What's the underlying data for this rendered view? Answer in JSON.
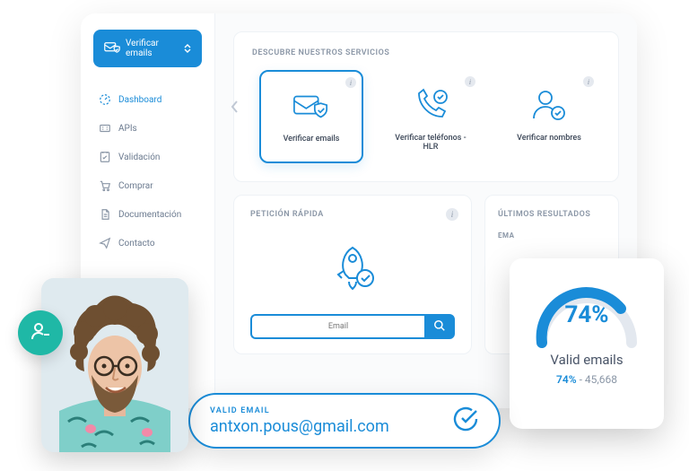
{
  "colors": {
    "primary": "#1a8cd8",
    "teal": "#1fb8a6",
    "muted": "#8a96a6"
  },
  "dropdown": {
    "label": "Verificar emails"
  },
  "nav": {
    "items": [
      {
        "label": "Dashboard",
        "icon": "dashboard-icon"
      },
      {
        "label": "APIs",
        "icon": "api-icon"
      },
      {
        "label": "Validación",
        "icon": "validation-icon"
      },
      {
        "label": "Comprar",
        "icon": "cart-icon"
      },
      {
        "label": "Documentación",
        "icon": "doc-icon"
      },
      {
        "label": "Contacto",
        "icon": "send-icon"
      }
    ]
  },
  "services": {
    "header": "DESCUBRE NUESTROS SERVICIOS",
    "items": [
      {
        "label": "Verificar emails"
      },
      {
        "label": "Verificar teléfonos - HLR"
      },
      {
        "label": "Verificar nombres"
      }
    ]
  },
  "quick": {
    "header": "PETICIÓN RÁPIDA",
    "placeholder": "Email"
  },
  "results": {
    "header": "ÚLTIMOS RESULTADOS",
    "col": "EMA"
  },
  "gauge": {
    "pct_label": "74%",
    "title": "Valid emails",
    "pct": "74%",
    "count": "45,668",
    "value": 74
  },
  "pill": {
    "tag": "VALID EMAIL",
    "address": "antxon.pous@gmail.com"
  }
}
